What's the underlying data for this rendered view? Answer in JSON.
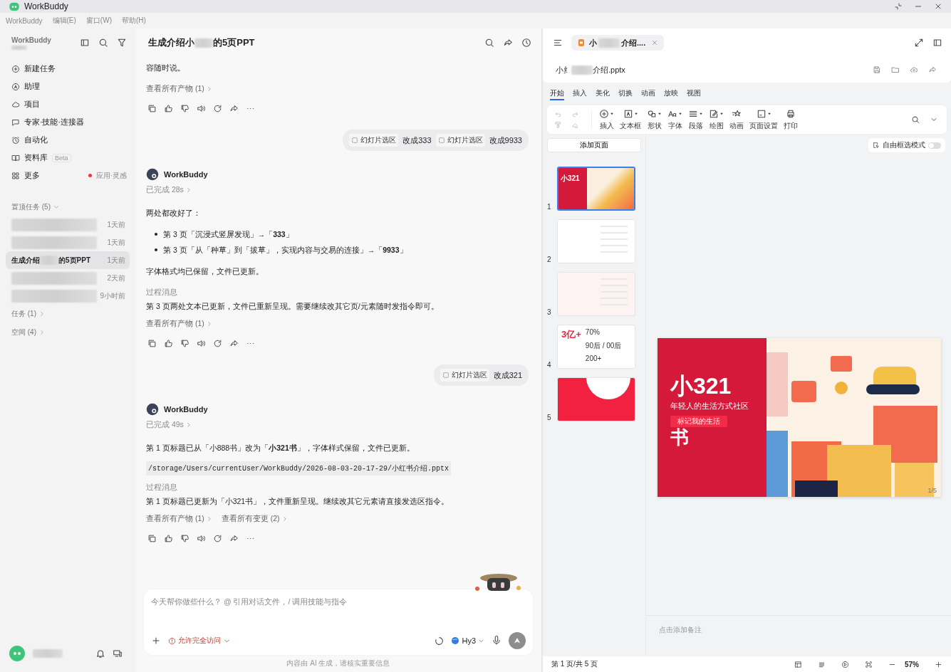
{
  "window": {
    "title": "WorkBuddy"
  },
  "menu": [
    "WorkBuddy",
    "编辑(E)",
    "窗口(W)",
    "帮助(H)"
  ],
  "sidebar": {
    "brand": "WorkBuddy",
    "nav": [
      {
        "label": "新建任务"
      },
      {
        "label": "助理"
      },
      {
        "label": "项目"
      },
      {
        "label": "专家·技能·连接器"
      },
      {
        "label": "自动化"
      },
      {
        "label": "资料库",
        "badge": "Beta"
      },
      {
        "label": "更多",
        "note": "应用·灵感",
        "unread": true
      }
    ],
    "pinned_header": "置顶任务 (5)",
    "pinned": [
      {
        "time": "1天前",
        "selected": false
      },
      {
        "time": "1天前",
        "selected": false
      },
      {
        "title_start": "生成介绍",
        "title_end": "的5页PPT",
        "time": "1天前",
        "selected": true
      },
      {
        "time": "2天前",
        "selected": false
      },
      {
        "time": "9小时前",
        "selected": false
      }
    ],
    "sections": [
      "任务 (1)",
      "空间 (4)"
    ]
  },
  "chat": {
    "title_start": "生成介绍小",
    "title_end": "的5页PPT",
    "blocks": [
      {
        "kind": "text",
        "text": "容随时说。"
      },
      {
        "kind": "links",
        "links": [
          "查看所有产物 (1)"
        ]
      },
      {
        "kind": "actions"
      },
      {
        "kind": "user",
        "chips": [
          {
            "tag": "幻灯片选区",
            "text": "改成333"
          },
          {
            "tag": "幻灯片选区",
            "text": "改成9933"
          }
        ]
      },
      {
        "kind": "author",
        "name": "WorkBuddy",
        "status": "已完成 28s"
      },
      {
        "kind": "text",
        "text": "两处都改好了："
      },
      {
        "kind": "bullets",
        "items": [
          "第 3 页「沉浸式竖屏发现」→「**333**」",
          "第 3 页「从「种草」到「拔草」，实现内容与交易的连接」→「**9933**」"
        ]
      },
      {
        "kind": "text",
        "text": "字体格式均已保留，文件已更新。"
      },
      {
        "kind": "process",
        "label": "过程消息",
        "text": "第 3 页两处文本已更新，文件已重新呈现。需要继续改其它页/元素随时发指令即可。"
      },
      {
        "kind": "links",
        "links": [
          "查看所有产物 (1)"
        ]
      },
      {
        "kind": "actions"
      },
      {
        "kind": "user",
        "chips": [
          {
            "tag": "幻灯片选区",
            "text": "改成321"
          }
        ]
      },
      {
        "kind": "author",
        "name": "WorkBuddy",
        "status": "已完成 49s"
      },
      {
        "kind": "text",
        "text": "第 1 页标题已从「小888书」改为「**小321书**」，字体样式保留，文件已更新。"
      },
      {
        "kind": "code",
        "text": "/storage/Users/currentUser/WorkBuddy/2026-08-03-20-17-29/小红书介绍.pptx"
      },
      {
        "kind": "process",
        "label": "过程消息",
        "text": "第 1 页标题已更新为「小321书」，文件重新呈现。继续改其它元素请直接发选区指令。"
      },
      {
        "kind": "links",
        "links": [
          "查看所有产物 (1)",
          "查看所有变更 (2)"
        ]
      },
      {
        "kind": "actions"
      }
    ],
    "composer": {
      "placeholder": "今天帮你做些什么？ @ 引用对话文件，/ 调用技能与指令",
      "access": "允许完全访问",
      "model": "Hy3"
    },
    "disclaimer": "内容由 AI 生成，请核实重要信息"
  },
  "doc": {
    "tab_start": "小",
    "tab_end": "介绍....",
    "file_start": "小纟",
    "file_end": "介绍.pptx",
    "ribbon_tabs": [
      {
        "label": "开始",
        "selected": true
      },
      {
        "label": "插入",
        "selected": false
      },
      {
        "label": "美化",
        "selected": false
      },
      {
        "label": "切换",
        "selected": false
      },
      {
        "label": "动画",
        "selected": false
      },
      {
        "label": "放映",
        "selected": false
      },
      {
        "label": "视图",
        "selected": false
      }
    ],
    "edit_buttons": [
      {
        "disabled": true
      },
      {
        "disabled": true
      },
      {
        "disabled": true
      },
      {
        "disabled": true
      }
    ],
    "tools": [
      {
        "label": "插入",
        "dropdown": true
      },
      {
        "label": "文本框",
        "dropdown": true
      },
      {
        "label": "形状",
        "dropdown": true
      },
      {
        "label": "字体",
        "dropdown": true
      },
      {
        "label": "段落",
        "dropdown": true
      },
      {
        "label": "绘图",
        "dropdown": true
      },
      {
        "label": "动画",
        "dropdown": false
      },
      {
        "label": "页面设置",
        "dropdown": true
      },
      {
        "label": "打印",
        "dropdown": false
      }
    ],
    "add_page": "添加页面",
    "free_select": {
      "label": "自由框选模式",
      "on": false
    },
    "slides": [
      {
        "number": "1",
        "selected": true,
        "texts": [
          "小321"
        ]
      },
      {
        "number": "2",
        "selected": false
      },
      {
        "number": "3",
        "selected": false
      },
      {
        "number": "4",
        "selected": false,
        "texts": [
          "3亿+",
          "70%",
          "90后 / 00后",
          "200+"
        ]
      },
      {
        "number": "5",
        "selected": false
      }
    ],
    "slide": {
      "title": "小321",
      "subtitle": "年轻人的生活方式社区",
      "title_tail": "书",
      "tag": "标记我的生活",
      "page": "1/5"
    },
    "notes_placeholder": "点击添加备注",
    "page_status": "第 1 页/共 5 页",
    "zoom": "57%"
  }
}
